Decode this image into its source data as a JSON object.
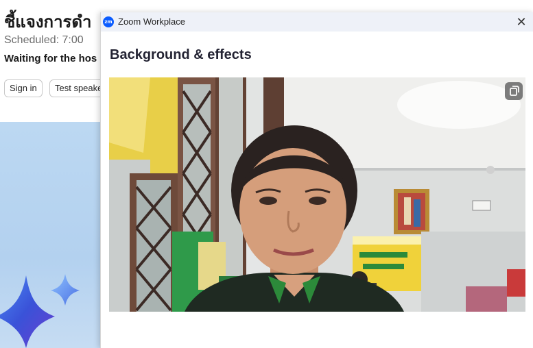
{
  "background_window": {
    "title": "ชี้แจงการดำ",
    "scheduled": "Scheduled: 7:00",
    "waiting": "Waiting for the hos",
    "buttons": {
      "sign_in": "Sign in",
      "test_speaker": "Test speake"
    }
  },
  "dialog": {
    "app_title": "Zoom Workplace",
    "logo_text": "zm",
    "close_glyph": "✕",
    "heading": "Background & effects"
  },
  "icons": {
    "zoom_logo": "zoom-logo-icon",
    "close": "close-icon",
    "mirror": "mirror-video-icon",
    "sparkle": "sparkle-icon"
  },
  "colors": {
    "zoom_blue": "#0b5cff",
    "titlebar": "#eef1f8",
    "panel_blue": "#bcd8f2"
  }
}
